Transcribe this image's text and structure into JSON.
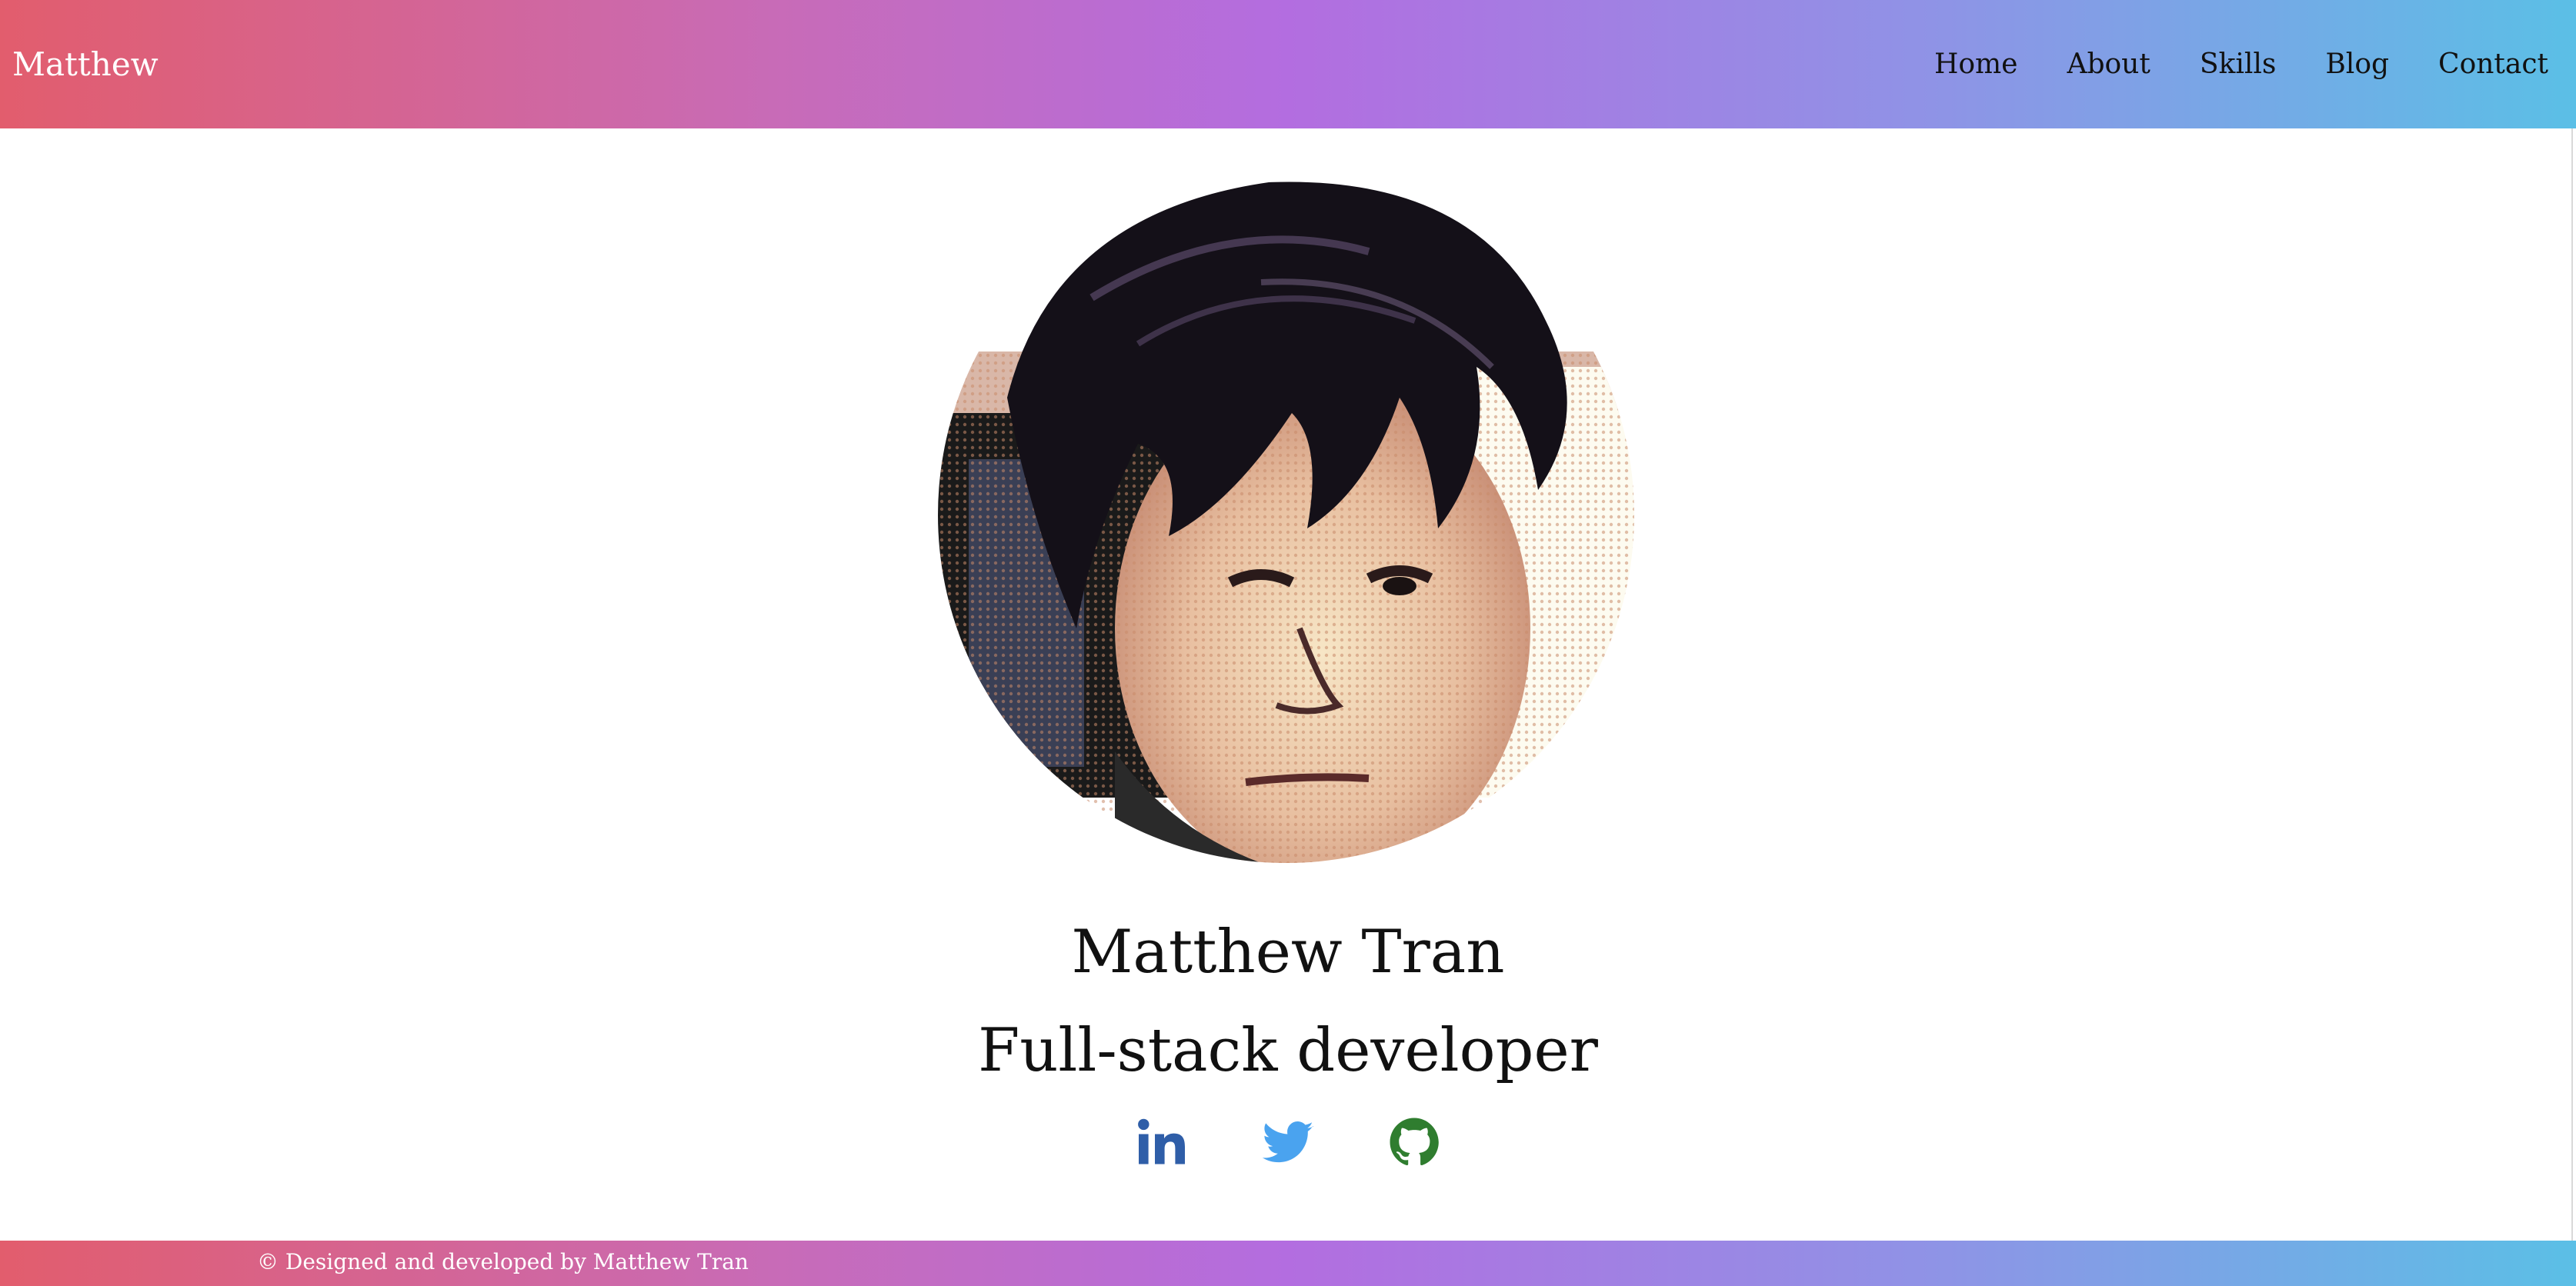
{
  "header": {
    "brand": "Matthew",
    "nav": [
      {
        "label": "Home"
      },
      {
        "label": "About"
      },
      {
        "label": "Skills"
      },
      {
        "label": "Blog"
      },
      {
        "label": "Contact"
      }
    ]
  },
  "profile": {
    "name": "Matthew Tran",
    "role": "Full-stack developer"
  },
  "social": [
    {
      "name": "linkedin",
      "icon": "linkedin-icon",
      "color": "#2f5ea8"
    },
    {
      "name": "twitter",
      "icon": "twitter-icon",
      "color": "#4aa3ef"
    },
    {
      "name": "github",
      "icon": "github-icon",
      "color": "#2f7d2f"
    }
  ],
  "footer": {
    "text": "© Designed and developed by Matthew Tran"
  },
  "colors": {
    "gradient_start": "#e25d6d",
    "gradient_mid": "#b36de0",
    "gradient_end": "#5bbfe6"
  }
}
